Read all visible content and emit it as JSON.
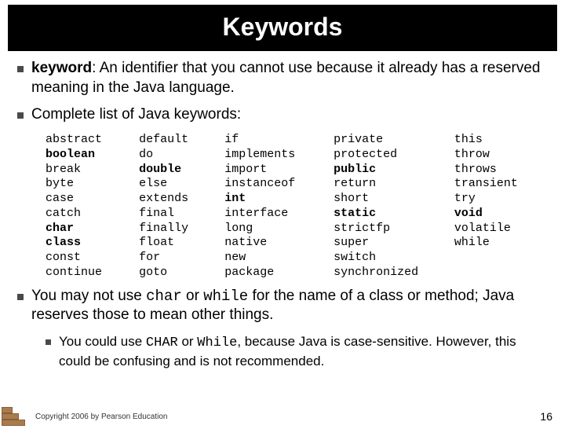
{
  "title": "Keywords",
  "bullet1_term": "keyword",
  "bullet1_rest": ": An identifier that you cannot use because it already has a reserved meaning in the Java language.",
  "bullet2": "Complete list of Java keywords:",
  "keywords": {
    "col1": [
      "abstract",
      "boolean",
      "break",
      "byte",
      "case",
      "catch",
      "char",
      "class",
      "const",
      "continue"
    ],
    "col2": [
      "default",
      "do",
      "double",
      "else",
      "extends",
      "final",
      "finally",
      "float",
      "for",
      "goto"
    ],
    "col3": [
      "if",
      "implements",
      "import",
      "instanceof",
      "int",
      "interface",
      "long",
      "native",
      "new",
      "package"
    ],
    "col4": [
      "private",
      "protected",
      "public",
      "return",
      "short",
      "static",
      "strictfp",
      "super",
      "switch",
      "synchronized"
    ],
    "col5": [
      "this",
      "throw",
      "throws",
      "transient",
      "try",
      "void",
      "volatile",
      "while"
    ],
    "bold": [
      "boolean",
      "char",
      "class",
      "double",
      "int",
      "public",
      "static",
      "void"
    ]
  },
  "bullet3_pre": "You may not use ",
  "bullet3_code1": "char",
  "bullet3_mid1": " or ",
  "bullet3_code2": "while",
  "bullet3_post": " for the name of a class or method; Java reserves those to mean other things.",
  "subbullet_pre": "You could use ",
  "subbullet_code1": "CHAR",
  "subbullet_mid1": " or ",
  "subbullet_code2": "While",
  "subbullet_post": ", because Java is case-sensitive. However, this could be confusing and is not recommended.",
  "copyright": "Copyright 2006 by Pearson Education",
  "page_number": "16"
}
